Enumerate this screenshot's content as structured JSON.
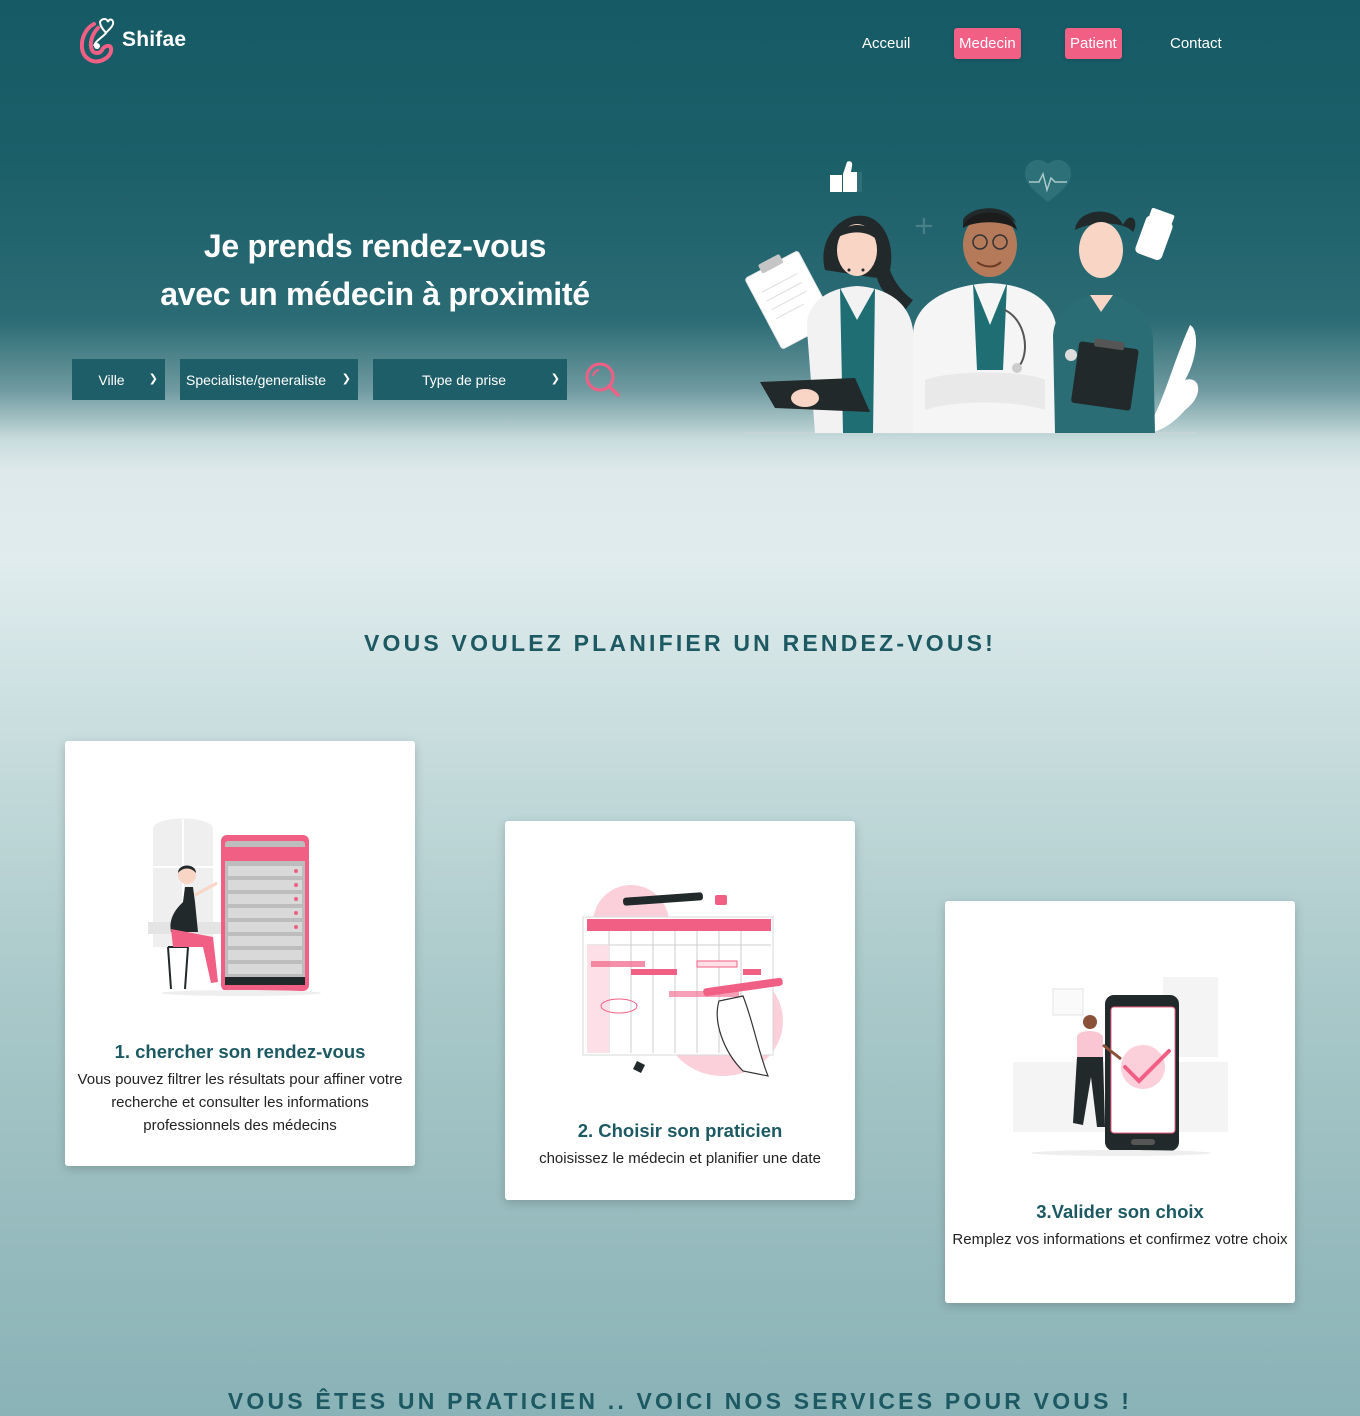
{
  "brand": {
    "name": "Shifae",
    "accent": "#f15f85",
    "primary": "#1c5962"
  },
  "nav": {
    "items": [
      {
        "label": "Acceuil"
      },
      {
        "label": "Medecin"
      },
      {
        "label": "Patient"
      },
      {
        "label": "Contact"
      }
    ]
  },
  "hero": {
    "title_line1": "Je prends rendez-vous",
    "title_line2": "avec un médecin à proximité",
    "filters": {
      "city": "Ville",
      "specialty": "Specialiste/generaliste",
      "type": "Type de prise"
    },
    "search_icon": "magnifier-icon"
  },
  "plan": {
    "title": "VOUS VOULEZ PLANIFIER UN RENDEZ-VOUS!",
    "cards": [
      {
        "title": "1. chercher son rendez-vous",
        "text": "Vous pouvez filtrer les résultats pour affiner votre recherche et consulter les informations professionnels des médecins",
        "icon": "phone-list-illustration"
      },
      {
        "title": "2. Choisir son praticien",
        "text": "choisissez le médecin et planifier une date",
        "icon": "calendar-planning-illustration"
      },
      {
        "title": "3.Valider son choix",
        "text": "Remplez vos informations et confirmez votre choix",
        "icon": "phone-check-illustration"
      }
    ]
  },
  "services": {
    "title": "VOUS ÊTES UN PRATICIEN .. VOICI NOS SERVICES POUR VOUS !"
  }
}
